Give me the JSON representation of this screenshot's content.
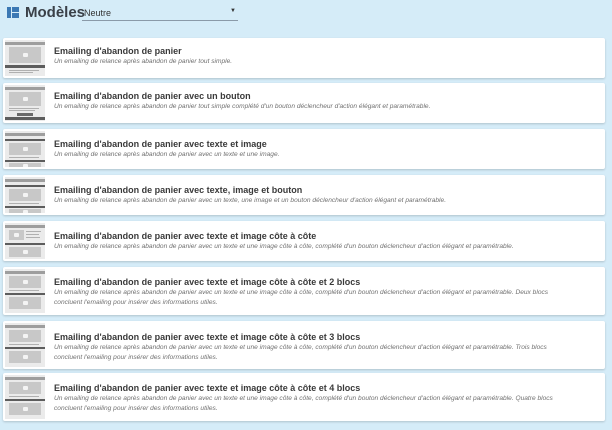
{
  "header": {
    "icon": "grid-icon",
    "title": "Modèles",
    "select_value": "Neutre",
    "select_caret": "▼"
  },
  "templates": [
    {
      "title": "Emailing d'abandon de panier",
      "description": "Un emailing de relance après abandon de panier tout simple."
    },
    {
      "title": "Emailing d'abandon de panier avec un bouton",
      "description": "Un emailing de relance après abandon de panier tout simple complété d'un bouton déclencheur d'action élégant et paramétrable."
    },
    {
      "title": "Emailing d'abandon de panier avec texte et image",
      "description": "Un emailing de relance après abandon de panier avec un texte et une image."
    },
    {
      "title": "Emailing d'abandon de panier avec texte, image et bouton",
      "description": "Un emailing de relance après abandon de panier avec un texte, une image et un bouton déclencheur d'action élégant et paramétrable."
    },
    {
      "title": "Emailing d'abandon de panier avec texte et image côte à côte",
      "description": "Un emailing de relance après abandon de panier avec un texte et une image côte à côte, complété d'un bouton déclencheur d'action élégant et paramétrable."
    },
    {
      "title": "Emailing d'abandon de panier avec texte et image côte à côte et 2 blocs",
      "description": "Un emailing de relance après abandon de panier avec un texte et une image côte à côte, complété d'un bouton déclencheur d'action élégant et paramétrable. Deux blocs concluent l'emailing pour insérer des informations utiles."
    },
    {
      "title": "Emailing d'abandon de panier avec texte et image côte à côte et 3 blocs",
      "description": "Un emailing de relance après abandon de panier avec un texte et une image côte à côte, complété d'un bouton déclencheur d'action élégant et paramétrable. Trois blocs concluent l'emailing pour insérer des informations utiles."
    },
    {
      "title": "Emailing d'abandon de panier avec texte et image côte à côte et 4 blocs",
      "description": "Un emailing de relance après abandon de panier avec un texte et une image côte à côte, complété d'un bouton déclencheur d'action élégant et paramétrable. Quatre blocs concluent l'emailing pour insérer des informations utiles."
    }
  ]
}
